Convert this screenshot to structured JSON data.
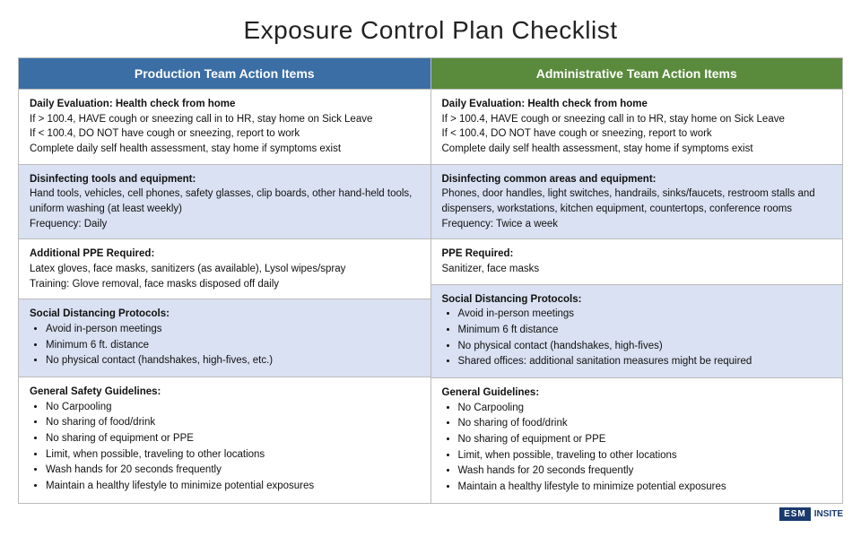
{
  "title": "Exposure Control Plan Checklist",
  "left_header": "Production Team Action Items",
  "right_header": "Administrative Team Action Items",
  "rows": [
    {
      "shaded": false,
      "left": {
        "type": "text",
        "lines": [
          "Daily Evaluation: Health check from home",
          "If > 100.4, HAVE cough or sneezing call in to HR, stay home on Sick Leave",
          "If < 100.4, DO NOT have cough or sneezing, report to work",
          "Complete daily self health assessment, stay home if symptoms exist"
        ]
      },
      "right": {
        "type": "text",
        "lines": [
          "Daily Evaluation: Health check from home",
          "If > 100.4, HAVE cough or sneezing call in to HR, stay home on Sick Leave",
          "If < 100.4, DO NOT have cough or sneezing, report to work",
          "Complete daily self health assessment, stay home if symptoms exist"
        ]
      }
    },
    {
      "shaded": true,
      "left": {
        "type": "text",
        "lines": [
          "Disinfecting tools and equipment:",
          "Hand tools, vehicles, cell phones, safety glasses, clip boards, other hand-held tools, uniform washing (at least weekly)",
          "Frequency: Daily"
        ]
      },
      "right": {
        "type": "text",
        "lines": [
          "Disinfecting common areas and equipment:",
          "Phones, door handles, light switches, handrails, sinks/faucets, restroom stalls and dispensers, workstations, kitchen equipment, countertops, conference rooms",
          "Frequency: Twice a week"
        ]
      }
    },
    {
      "shaded": false,
      "left": {
        "type": "text",
        "lines": [
          "Additional PPE Required:",
          "Latex gloves, face masks, sanitizers (as available), Lysol wipes/spray",
          "Training: Glove removal, face masks disposed off daily"
        ]
      },
      "right": {
        "type": "text",
        "lines": [
          "PPE Required:",
          "Sanitizer, face masks"
        ]
      }
    },
    {
      "shaded": true,
      "left": {
        "type": "list",
        "heading": "Social Distancing Protocols:",
        "items": [
          "Avoid in-person meetings",
          "Minimum 6 ft. distance",
          "No physical contact (handshakes, high-fives, etc.)"
        ]
      },
      "right": {
        "type": "list",
        "heading": "Social Distancing Protocols:",
        "items": [
          "Avoid in-person meetings",
          "Minimum 6 ft distance",
          "No physical contact (handshakes, high-fives)",
          "Shared offices: additional sanitation measures might be required"
        ]
      }
    },
    {
      "shaded": false,
      "left": {
        "type": "list",
        "heading": "General Safety Guidelines:",
        "items": [
          "No Carpooling",
          "No sharing of food/drink",
          "No sharing of equipment or PPE",
          "Limit, when possible, traveling to other locations",
          "Wash hands for 20 seconds frequently",
          "Maintain a healthy lifestyle to minimize potential exposures"
        ]
      },
      "right": {
        "type": "list",
        "heading": "General Guidelines:",
        "items": [
          "No Carpooling",
          "No sharing of food/drink",
          "No sharing of equipment or PPE",
          "Limit, when possible, traveling to other locations",
          "Wash hands for 20 seconds frequently",
          "Maintain a healthy lifestyle to minimize potential exposures"
        ]
      }
    }
  ],
  "footer": {
    "badge": "ESM",
    "badge_suffix": "INSITE"
  }
}
